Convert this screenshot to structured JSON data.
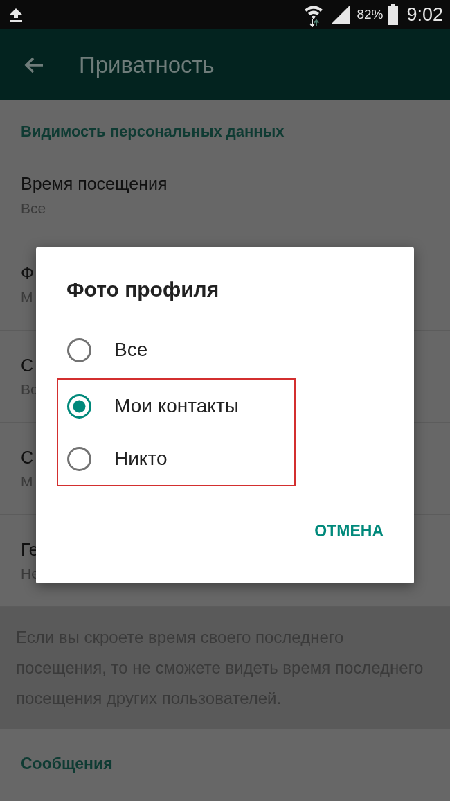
{
  "status_bar": {
    "battery": "82%",
    "time": "9:02"
  },
  "toolbar": {
    "title": "Приватность"
  },
  "section": "Видимость персональных данных",
  "rows": [
    {
      "title": "Время посещения",
      "value": "Все"
    },
    {
      "title": "Ф",
      "value": "М"
    },
    {
      "title": "С",
      "value": "Во"
    },
    {
      "title": "С",
      "value": "М"
    },
    {
      "title": "Ге",
      "value": "Не"
    }
  ],
  "note": "Если вы скроете время своего последнего посещения, то не сможете видеть время последнего посещения других пользователей.",
  "section_2": "Сообщения",
  "dialog": {
    "title": "Фото профиля",
    "options": [
      {
        "label": "Все",
        "selected": false,
        "highlighted": false
      },
      {
        "label": "Мои контакты",
        "selected": true,
        "highlighted": true
      },
      {
        "label": "Никто",
        "selected": false,
        "highlighted": true
      }
    ],
    "button": "ОТМЕНА"
  }
}
